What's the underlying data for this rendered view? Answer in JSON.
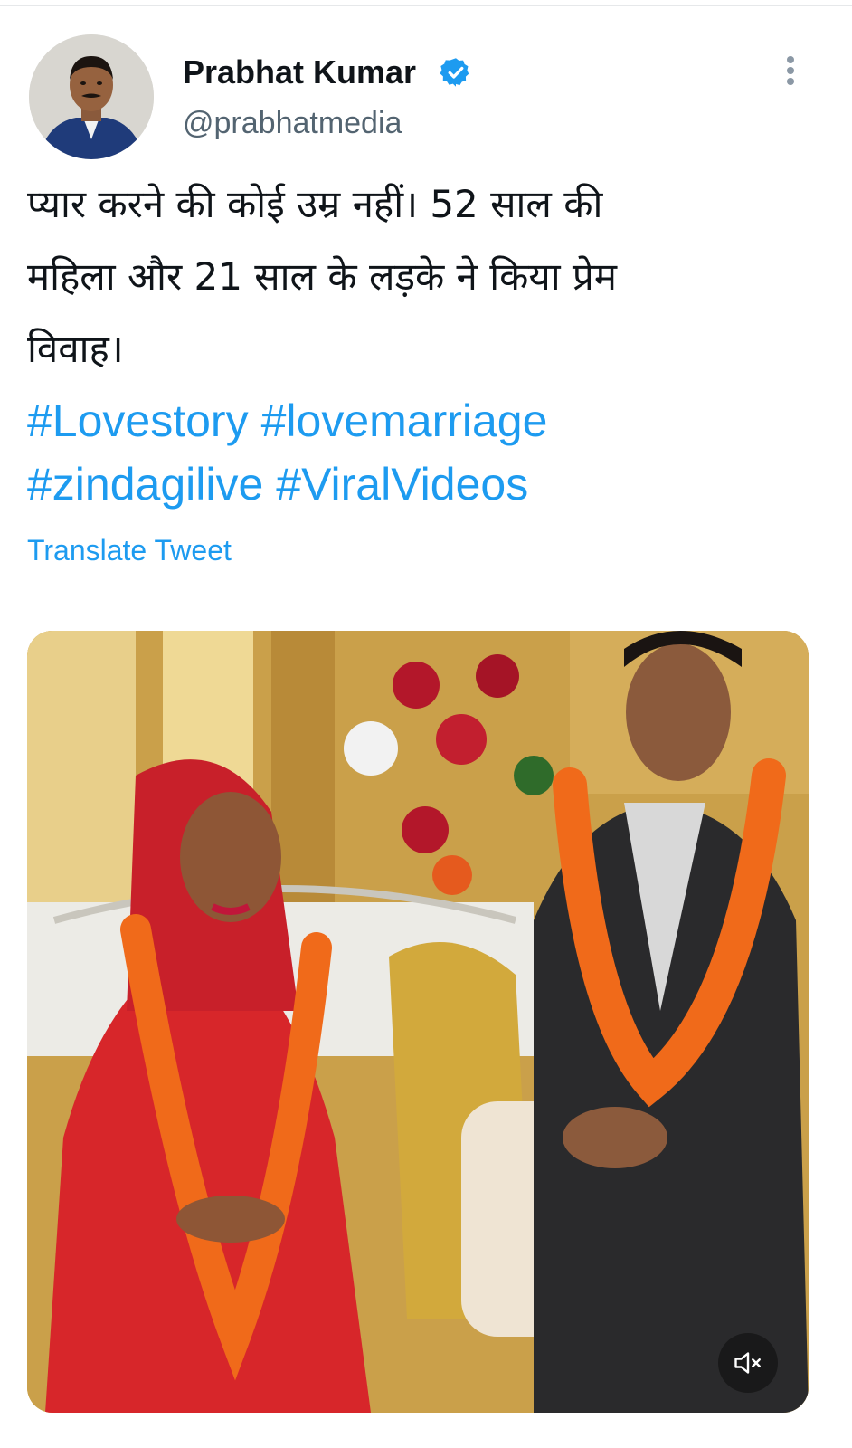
{
  "tweet": {
    "author": {
      "display_name": "Prabhat Kumar",
      "handle": "@prabhatmedia",
      "verified": true,
      "avatar_icon": "profile-photo"
    },
    "text_lines": [
      "प्यार करने की कोई उम्र नहीं। 52 साल की",
      "महिला और 21 साल के लड़के ने किया प्रेम",
      "विवाह।"
    ],
    "hashtags": [
      "#Lovestory",
      "#lovemarriage",
      "#zindagilive",
      "#ViralVideos"
    ],
    "translate_label": "Translate Tweet",
    "media": {
      "type": "video",
      "description_icon": "video-thumbnail",
      "muted": true,
      "mute_icon": "speaker-muted-icon"
    }
  },
  "colors": {
    "link": "#1d9bf0",
    "text": "#0f1419",
    "secondary_text": "#536471",
    "verified": "#1d9bf0"
  }
}
